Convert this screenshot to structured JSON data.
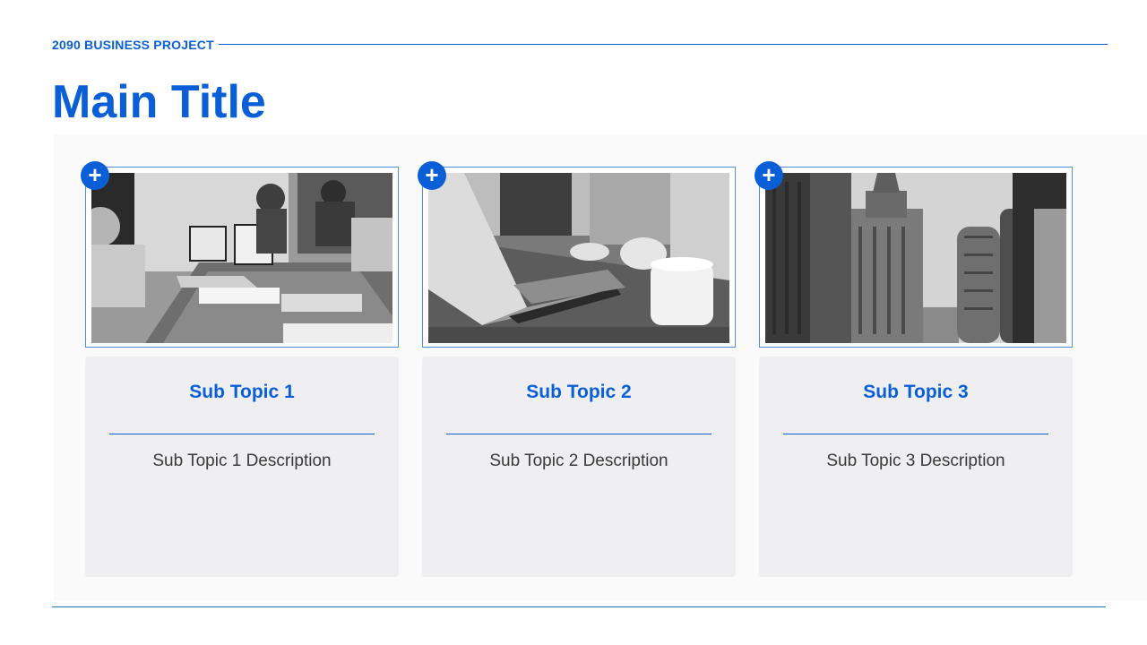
{
  "header": {
    "project_label": "2090 BUSINESS PROJECT",
    "title": "Main Title"
  },
  "cards": [
    {
      "badge": "+",
      "photo_icon": "meeting-photo",
      "title": "Sub Topic 1",
      "description": "Sub Topic 1 Description"
    },
    {
      "badge": "+",
      "photo_icon": "laptop-photo",
      "title": "Sub Topic 2",
      "description": "Sub Topic 2 Description"
    },
    {
      "badge": "+",
      "photo_icon": "city-buildings-photo",
      "title": "Sub Topic 3",
      "description": "Sub Topic 3 Description"
    }
  ],
  "colors": {
    "accent": "#0a5fd7",
    "panel": "#efeff1",
    "footer_rule": "#1a7bb8"
  }
}
